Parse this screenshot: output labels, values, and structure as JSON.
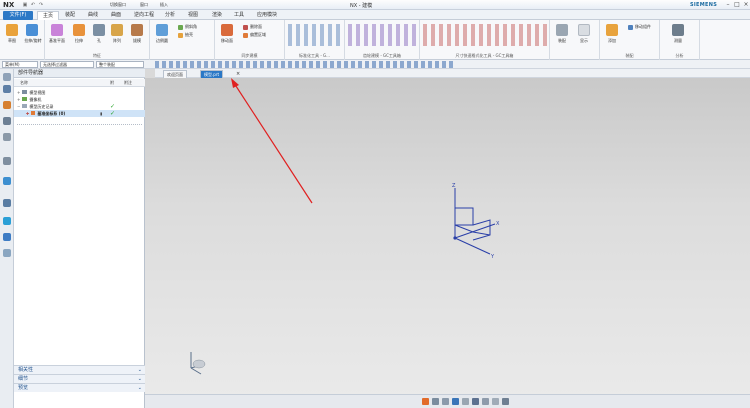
{
  "app": {
    "logo": "NX",
    "window_title": "NX - 建模",
    "brand": "SIEMENS",
    "quick_access": [
      "保存",
      "撤消",
      "重做",
      "切换窗口",
      "窗口",
      "插入"
    ]
  },
  "ribbon_tabs": {
    "file": "文件(F)",
    "items": [
      "主页",
      "装配",
      "曲线",
      "曲面",
      "逆向工程",
      "分析",
      "视图",
      "渲染",
      "工具",
      "应用模块"
    ],
    "active_index": 0
  },
  "ribbon": {
    "groups": [
      {
        "label": "",
        "buttons": [
          "草图",
          "拉伸/旋转"
        ]
      },
      {
        "label": "特征",
        "buttons": [
          "基准平面",
          "拉伸",
          "孔",
          "阵列",
          "拔模"
        ]
      },
      {
        "label": "",
        "buttons": [
          "边倒圆",
          "倒斜角",
          "抽壳"
        ]
      },
      {
        "label": "同步建模",
        "buttons": [
          "移动面",
          "删除面",
          "偏置区域"
        ]
      },
      {
        "label": "标准化工具 - G...",
        "buttons": []
      },
      {
        "label": "齿轮建模 - GC工具箱",
        "buttons": []
      },
      {
        "label": "尺寸快速格式化工具 - GC工具箱",
        "buttons": []
      },
      {
        "label": "",
        "buttons": [
          "装配",
          "显示"
        ]
      },
      {
        "label": "装配",
        "buttons": [
          "添加",
          "移动组件"
        ]
      },
      {
        "label": "分析",
        "buttons": [
          "测量"
        ]
      }
    ]
  },
  "toolbar": {
    "menu_label": "菜单(M)",
    "selection_filter": "无选择过滤器",
    "scope": "整个装配"
  },
  "graphics_tabs": [
    {
      "label": "欢迎页面",
      "active": false
    },
    {
      "label": "模型.prt",
      "active": true
    }
  ],
  "navigator": {
    "title": "部件导航器",
    "columns": [
      "名称",
      "附",
      "附注"
    ],
    "nodes": [
      {
        "label": "模型视图",
        "level": 1,
        "check": false
      },
      {
        "label": "摄像机",
        "level": 1,
        "check": false
      },
      {
        "label": "模型历史记录",
        "level": 1,
        "check": true
      },
      {
        "label": "基准坐标系 (0)",
        "level": 2,
        "check": true
      }
    ],
    "accordions": [
      "相关性",
      "细节",
      "预览"
    ]
  },
  "axes": {
    "x": "X",
    "y": "Y",
    "z": "Z"
  },
  "colors": {
    "accent": "#2b78c6",
    "graphics_bg_top": "#c9c9c9",
    "graphics_bg_bottom": "#eaeaea",
    "axis_color": "#2a3fa8",
    "arrow_color": "#e02020",
    "check_color": "#27a52b"
  }
}
